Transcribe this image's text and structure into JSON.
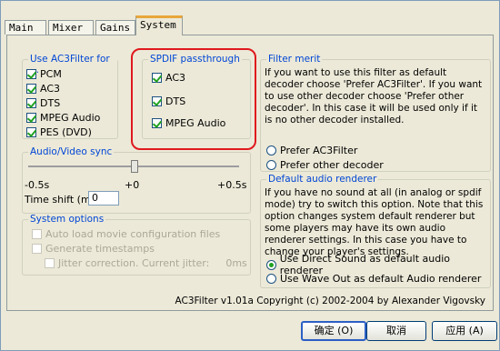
{
  "tabs": [
    "Main",
    "Mixer",
    "Gains",
    "System"
  ],
  "use_filter": {
    "title": "Use AC3Filter for ...",
    "items": [
      "PCM",
      "AC3",
      "DTS",
      "MPEG Audio",
      "PES (DVD)"
    ]
  },
  "spdif": {
    "title": "SPDIF passthrough",
    "items": [
      "AC3",
      "DTS",
      "MPEG Audio"
    ]
  },
  "filter_merit": {
    "title": "Filter merit",
    "text": "If you want to use this filter as default decoder choose 'Prefer AC3Filter'. If you want to use other decoder choose 'Prefer other decoder'. In this case it will be used only if it is no other decoder installed.",
    "options": [
      "Prefer AC3Filter",
      "Prefer other decoder"
    ]
  },
  "av_sync": {
    "title": "Audio/Video sync",
    "min": "-0.5s",
    "mid": "+0",
    "max": "+0.5s",
    "shift_label": "Time shift (ms):",
    "shift_value": "0",
    "slider_fraction": 0.5
  },
  "renderer": {
    "title": "Default audio renderer",
    "text": "If you have no sound at all (in analog or spdif mode) try to switch this option. Note that this option changes system default renderer but some players may have its own audio renderer settings. In this case you have to change your player's settings.",
    "options": [
      "Use Direct Sound as default audio renderer",
      "Use Wave Out as default Audio renderer"
    ]
  },
  "system_options": {
    "title": "System options",
    "items": [
      "Auto load movie configuration files",
      "Generate timestamps",
      "Jitter correction. Current jitter:"
    ],
    "jitter_value": "0ms"
  },
  "copyright": "AC3Filter v1.01a Copyright (c) 2002-2004 by Alexander Vigovsky",
  "buttons": {
    "ok": "确定 (O)",
    "cancel": "取消",
    "apply": "应用 (A)"
  }
}
